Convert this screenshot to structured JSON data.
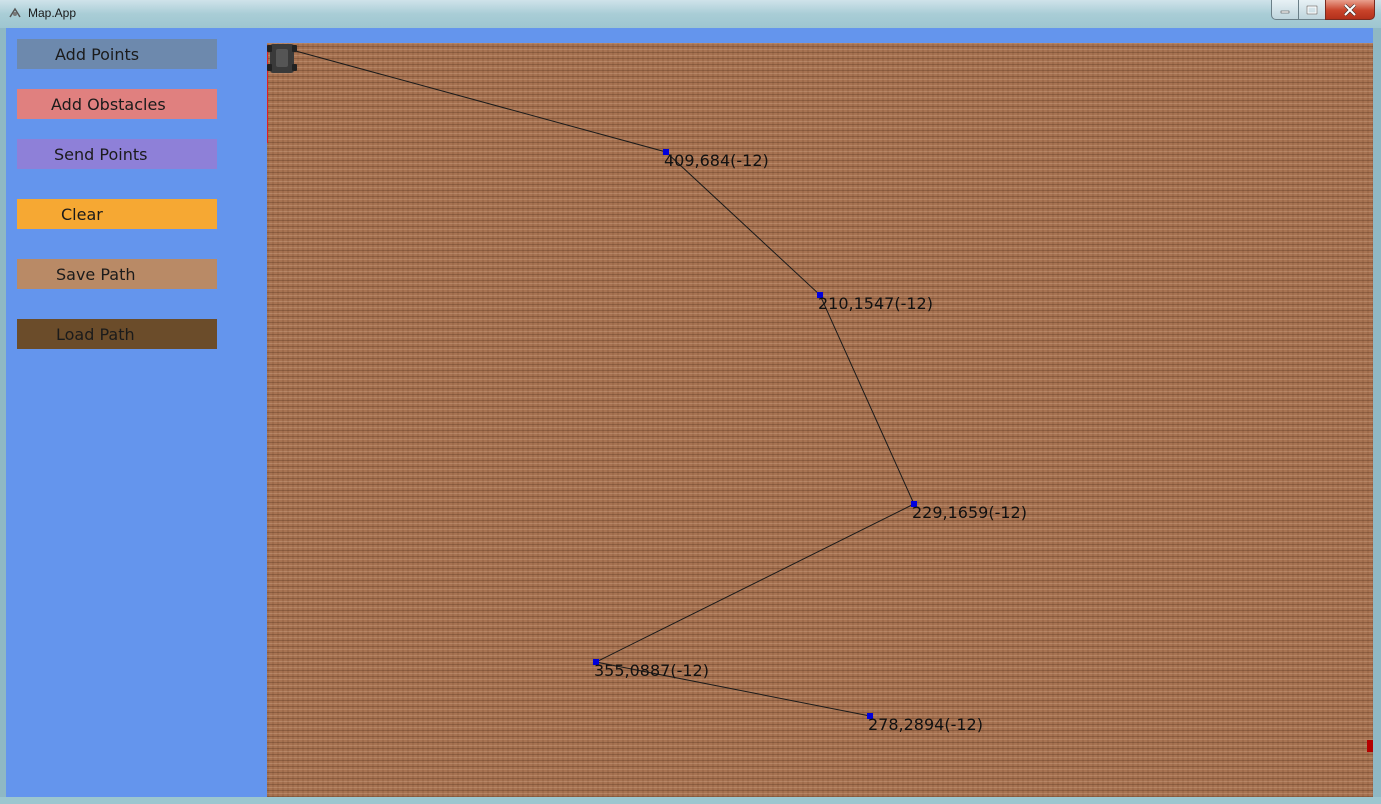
{
  "window": {
    "title": "Map.App"
  },
  "sidebar": {
    "buttons": [
      {
        "id": "add-points",
        "label": "Add Points",
        "color": "#6d89ad"
      },
      {
        "id": "add-obstacles",
        "label": "Add Obstacles",
        "color": "#e0807f"
      },
      {
        "id": "send-points",
        "label": "Send Points",
        "color": "#8e80d8"
      },
      {
        "id": "clear",
        "label": "Clear",
        "color": "#f6a833"
      },
      {
        "id": "save-path",
        "label": "Save Path",
        "color": "#b98a66"
      },
      {
        "id": "load-path",
        "label": "Load Path",
        "color": "#6b4c2a"
      }
    ]
  },
  "map": {
    "colors": {
      "ground": "#a77352",
      "path_line": "#1a1a1a",
      "waypoint": "#0000dd",
      "obstacle": "#b40000",
      "origin_axis": "#e02020",
      "robot": "#3a3a3a"
    },
    "robot_icon": "robot-icon",
    "waypoints": [
      {
        "label": "409,684(-12)"
      },
      {
        "label": "210,1547(-12)"
      },
      {
        "label": "229,1659(-12)"
      },
      {
        "label": "355,0887(-12)"
      },
      {
        "label": "278,2894(-12)"
      }
    ]
  }
}
